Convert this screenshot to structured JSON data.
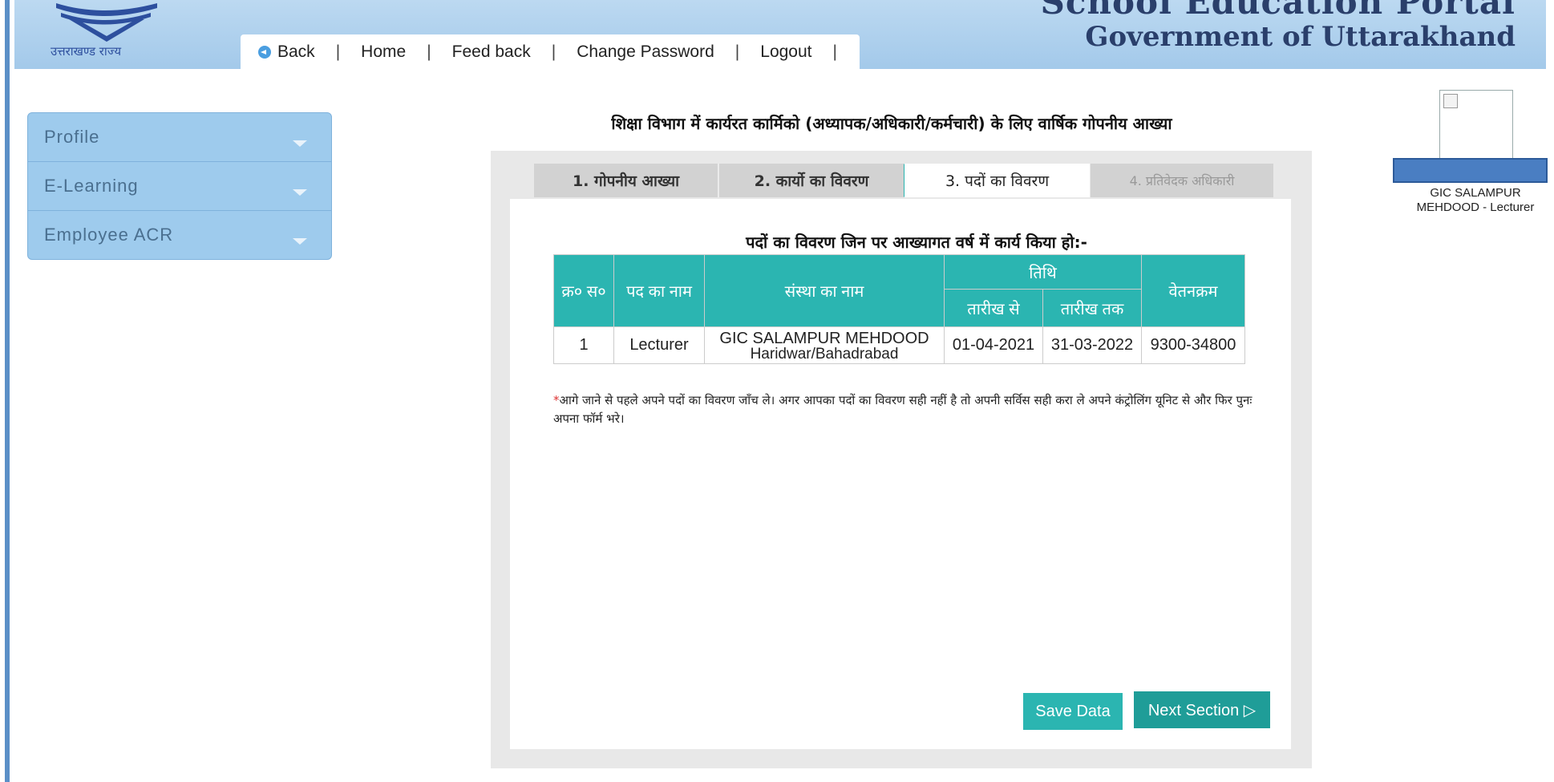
{
  "header": {
    "logo_caption": "उत्तराखण्ड राज्य",
    "banner_top": "School Education Portal",
    "banner_gov": "Government of Uttarakhand",
    "nav": {
      "back": "Back",
      "home": "Home",
      "feedback": "Feed back",
      "change_password": "Change Password",
      "logout": "Logout",
      "separator": "|"
    }
  },
  "sidebar": {
    "items": [
      {
        "label": "Profile"
      },
      {
        "label": "E-Learning"
      },
      {
        "label": "Employee ACR"
      }
    ]
  },
  "profile": {
    "name": "GIC SALAMPUR MEHDOOD - Lecturer"
  },
  "main": {
    "page_title": "शिक्षा विभाग में कार्यरत कार्मिको (अध्यापक/अधिकारी/कर्मचारी) के लिए वार्षिक गोपनीय आख्या",
    "tabs": [
      {
        "label": "1. गोपनीय आख्या"
      },
      {
        "label": "2. कार्यो का विवरण"
      },
      {
        "label": "3. पदों का विवरण"
      },
      {
        "label": "4. प्रतिवेदक अधिकारी"
      }
    ],
    "section_heading": "पदों का विवरण जिन पर आख्यागत वर्ष में कार्य किया हो:-",
    "table": {
      "headers": {
        "sno": "क्र० स०",
        "post": "पद का नाम",
        "institution": "संस्था का नाम",
        "date": "तिथि",
        "from": "तारीख से",
        "to": "तारीख तक",
        "pay": "वेतनक्रम"
      },
      "rows": [
        {
          "sno": "1",
          "post": "Lecturer",
          "institution": "GIC SALAMPUR MEHDOOD",
          "location": "Haridwar/Bahadrabad",
          "from": "01-04-2021",
          "to": "31-03-2022",
          "pay": "9300-34800"
        }
      ]
    },
    "note_mark": "*",
    "note": "आगे जाने से पहले अपने पदों का विवरण जाँच ले। अगर आपका पदों का विवरण सही नहीं है तो अपनी सर्विस सही करा ले अपने कंट्रोलिंग यूनिट से और फिर पुनः अपना फॉर्म भरे।",
    "buttons": {
      "save": "Save Data",
      "next": "Next Section ▷"
    }
  },
  "colors": {
    "header_bg": "#a3c9ea",
    "accent_teal": "#2bb5b1",
    "sidebar_bg": "#9ecbed",
    "banner_text": "#2a3f6b"
  }
}
